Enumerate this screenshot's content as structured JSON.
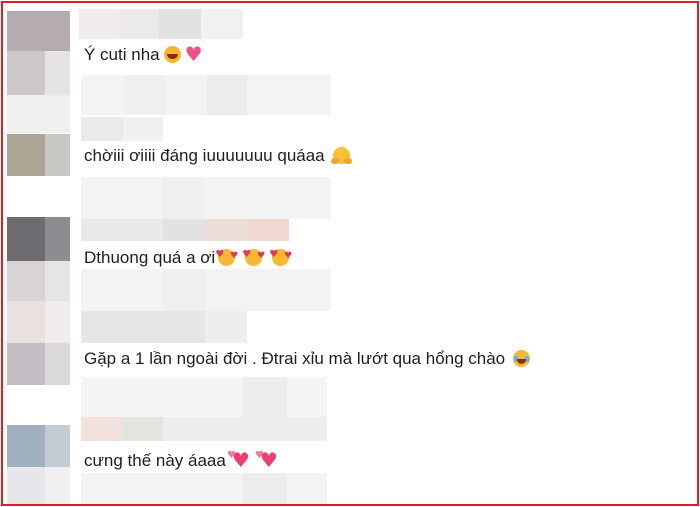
{
  "comments": [
    {
      "text": "Ý cuti nha",
      "emojis": [
        "grinning-squint-icon",
        "pink-heart-icon"
      ]
    },
    {
      "text": "chờiii ơiiii đáng iuuuuuuu quáaa",
      "emojis": [
        "hugging-face-icon"
      ]
    },
    {
      "text": "Dthuong quá a ơi",
      "emojis": [
        "smiling-face-with-hearts-icon",
        "smiling-face-with-hearts-icon",
        "smiling-face-with-hearts-icon"
      ]
    },
    {
      "text": "Gặp a 1 lần ngoài đời . Đtrai xỉu mà lướt qua hổng chào",
      "emojis": [
        "face-with-tears-of-joy-icon"
      ]
    },
    {
      "text": "cưng thế này áaaa",
      "emojis": [
        "growing-heart-icon",
        "growing-heart-icon"
      ]
    }
  ],
  "colors": {
    "border": "#e02020",
    "text": "#1c1e21"
  }
}
